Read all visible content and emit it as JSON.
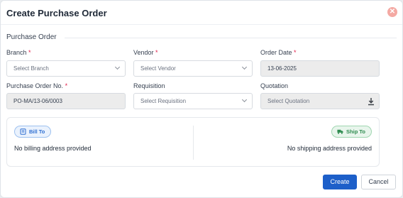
{
  "dialog": {
    "title": "Create Purchase Order",
    "close_icon": "close-icon",
    "section_title": "Purchase Order"
  },
  "fields": {
    "branch": {
      "label": "Branch",
      "required": "*",
      "placeholder": "Select Branch"
    },
    "vendor": {
      "label": "Vendor",
      "required": "*",
      "placeholder": "Select Vendor"
    },
    "order_date": {
      "label": "Order Date",
      "required": "*",
      "value": "13-06-2025"
    },
    "po_number": {
      "label": "Purchase Order No.",
      "required": "*",
      "value": "PO-MA/13-06/0003"
    },
    "requisition": {
      "label": "Requisition",
      "placeholder": "Select Requisition"
    },
    "quotation": {
      "label": "Quotation",
      "placeholder": "Select Quotation",
      "icon": "download-icon"
    }
  },
  "address": {
    "bill_to": {
      "label": "Bill To",
      "icon": "bill-icon",
      "text": "No billing address provided"
    },
    "ship_to": {
      "label": "Ship To",
      "icon": "truck-icon",
      "text": "No shipping address provided"
    }
  },
  "actions": {
    "create_label": "Create",
    "cancel_label": "Cancel"
  },
  "colors": {
    "primary": "#1d5fc9",
    "required": "#e11d48",
    "close": "#f4a9a3",
    "bill_accent": "#2f6fd1",
    "ship_accent": "#2e8b4f"
  }
}
